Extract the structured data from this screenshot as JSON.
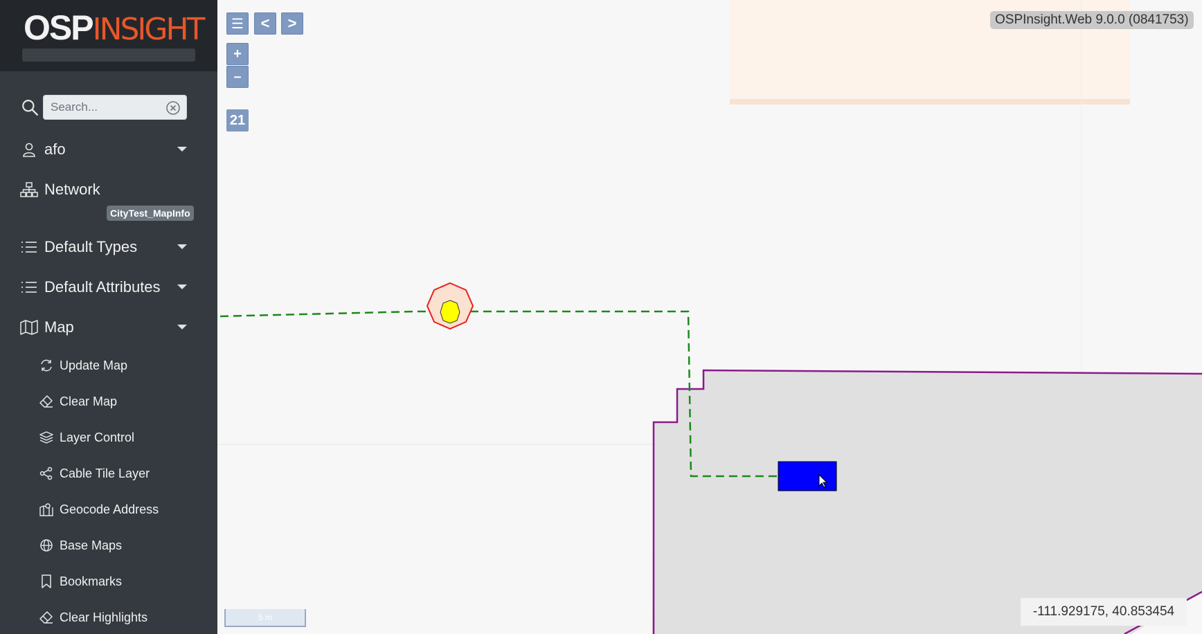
{
  "app": {
    "logo_part1": "OSP",
    "logo_part2": "INSIGHT",
    "version": "OSPInsight.Web 9.0.0 (0841753)"
  },
  "search": {
    "placeholder": "Search...",
    "value": ""
  },
  "sidebar": {
    "user": "afo",
    "network": "Network",
    "network_badge": "CityTest_MapInfo",
    "default_types": "Default Types",
    "default_attributes": "Default Attributes",
    "map": "Map",
    "map_items": [
      {
        "label": "Update Map",
        "icon": "refresh-icon"
      },
      {
        "label": "Clear Map",
        "icon": "eraser-icon"
      },
      {
        "label": "Layer Control",
        "icon": "layers-icon"
      },
      {
        "label": "Cable Tile Layer",
        "icon": "share-nodes-icon"
      },
      {
        "label": "Geocode Address",
        "icon": "map-marker-icon"
      },
      {
        "label": "Base Maps",
        "icon": "globe-icon"
      },
      {
        "label": "Bookmarks",
        "icon": "bookmark-icon"
      },
      {
        "label": "Clear Highlights",
        "icon": "eraser-icon"
      }
    ]
  },
  "map_controls": {
    "menu": "☰",
    "back": "<",
    "forward": ">",
    "zoom_in": "+",
    "zoom_out": "–",
    "zoom_level": "21"
  },
  "map_status": {
    "coordinates": "-111.929175, 40.853454",
    "scale": "5 m"
  },
  "colors": {
    "sidebar_bg": "#343a40",
    "logo_bg": "#23272b",
    "accent_orange": "#e8572a",
    "button_blue": "#7f99c0",
    "cable_green": "#1a8a1a",
    "boundary_purple": "#8a1a8a",
    "selected_blue": "#0000ff",
    "node_red": "#e82020",
    "node_yellow": "#ffff00"
  }
}
